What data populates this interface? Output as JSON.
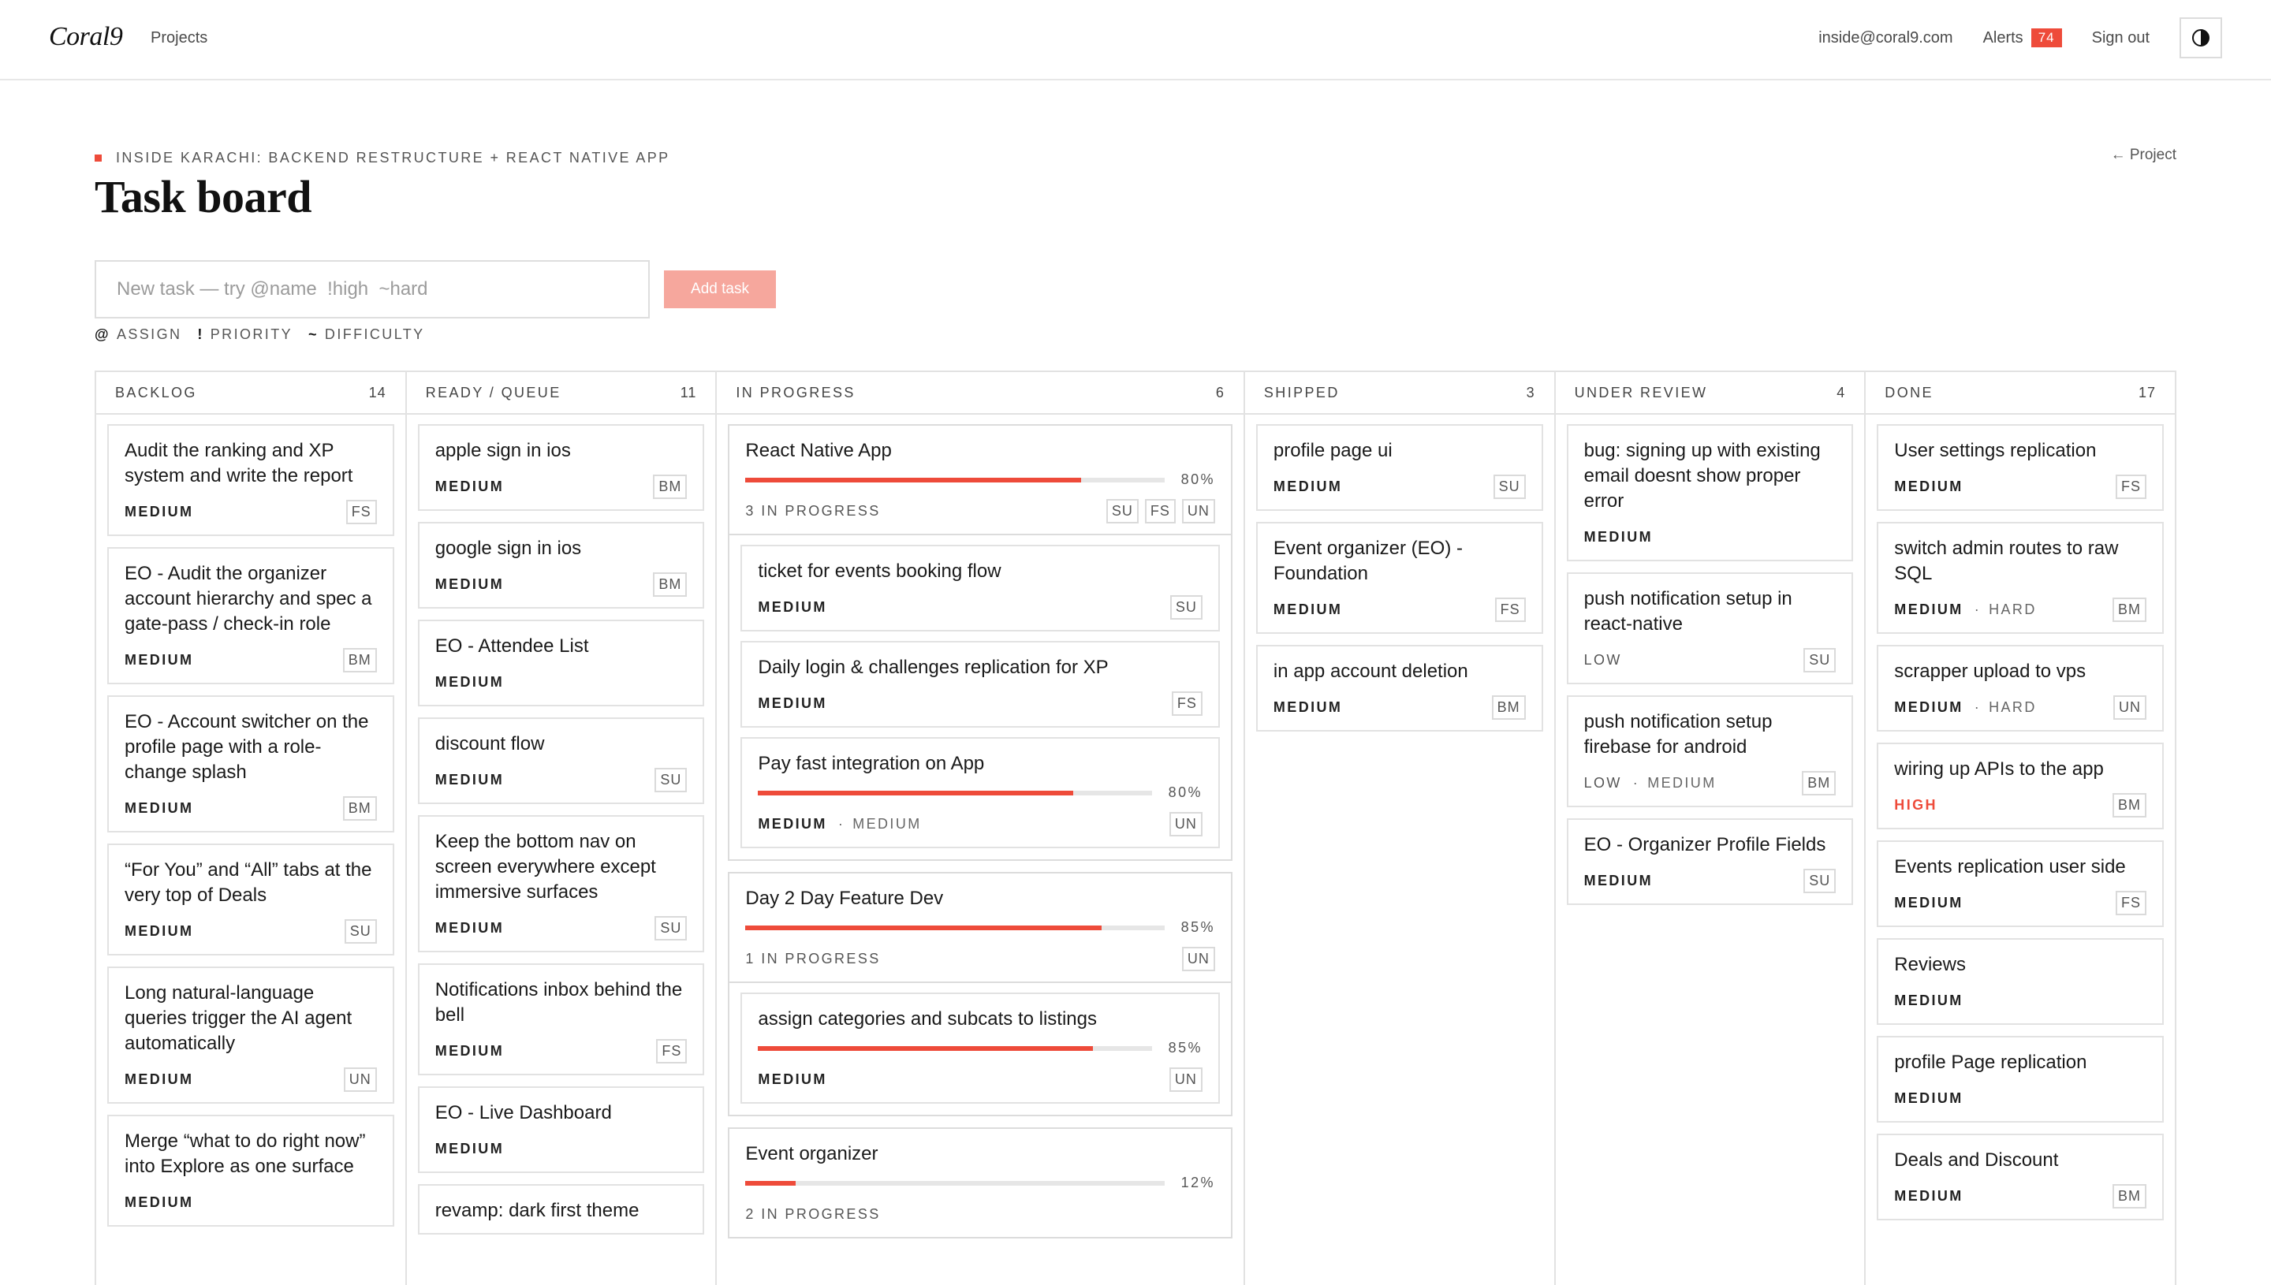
{
  "nav": {
    "logo": "Coral9",
    "projects": "Projects",
    "email": "inside@coral9.com",
    "alerts_label": "Alerts",
    "alerts_count": "74",
    "signout": "Sign out",
    "theme_icon": "contrast-icon"
  },
  "header": {
    "breadcrumb": "INSIDE KARACHI: BACKEND RESTRUCTURE + REACT NATIVE APP",
    "title": "Task board",
    "back_link": "← Project"
  },
  "new_task": {
    "placeholder": "New task — try @name  !high  ~hard",
    "button": "Add task",
    "hints": [
      {
        "symbol": "@",
        "label": "ASSIGN"
      },
      {
        "symbol": "!",
        "label": "PRIORITY"
      },
      {
        "symbol": "~",
        "label": "DIFFICULTY"
      }
    ]
  },
  "colors": {
    "accent": "#ee4b3a",
    "accent_light": "#f6a79d",
    "border": "#e2e2e2"
  },
  "columns": [
    {
      "name": "BACKLOG",
      "count": "14",
      "cards": [
        {
          "title": "Audit the ranking and XP system and write the report",
          "priority": "MEDIUM",
          "assignee": "FS"
        },
        {
          "title": "EO - Audit the organizer account hierarchy and spec a gate-pass / check-in role",
          "priority": "MEDIUM",
          "assignee": "BM"
        },
        {
          "title": "EO - Account switcher on the profile page with a role-change splash",
          "priority": "MEDIUM",
          "assignee": "BM"
        },
        {
          "title": "“For You” and “All” tabs at the very top of Deals",
          "priority": "MEDIUM",
          "assignee": "SU"
        },
        {
          "title": "Long natural-language queries trigger the AI agent automatically",
          "priority": "MEDIUM",
          "assignee": "UN"
        },
        {
          "title": "Merge “what to do right now” into Explore as one surface",
          "priority": "MEDIUM",
          "assignee": ""
        }
      ]
    },
    {
      "name": "READY / QUEUE",
      "count": "11",
      "cards": [
        {
          "title": "apple sign in ios",
          "priority": "MEDIUM",
          "assignee": "BM"
        },
        {
          "title": "google sign in ios",
          "priority": "MEDIUM",
          "assignee": "BM"
        },
        {
          "title": "EO - Attendee List",
          "priority": "MEDIUM",
          "assignee": ""
        },
        {
          "title": "discount flow",
          "priority": "MEDIUM",
          "assignee": "SU"
        },
        {
          "title": "Keep the bottom nav on screen everywhere except immersive surfaces",
          "priority": "MEDIUM",
          "assignee": "SU"
        },
        {
          "title": "Notifications inbox behind the bell",
          "priority": "MEDIUM",
          "assignee": "FS"
        },
        {
          "title": "EO - Live Dashboard",
          "priority": "MEDIUM",
          "assignee": ""
        },
        {
          "title": "revamp: dark first theme",
          "priority": "",
          "assignee": ""
        }
      ]
    },
    {
      "name": "IN PROGRESS",
      "count": "6",
      "epics": [
        {
          "title": "React Native App",
          "progress": 80,
          "progress_label": "80%",
          "status": "3 IN PROGRESS",
          "assignees": [
            "SU",
            "FS",
            "UN"
          ],
          "children": [
            {
              "title": "ticket for events booking flow",
              "priority": "MEDIUM",
              "difficulty": "",
              "assignee": "SU"
            },
            {
              "title": "Daily login & challenges replication for XP",
              "priority": "MEDIUM",
              "difficulty": "",
              "assignee": "FS"
            },
            {
              "title": "Pay fast integration on App",
              "priority": "MEDIUM",
              "difficulty": "MEDIUM",
              "assignee": "UN",
              "progress": 80,
              "progress_label": "80%"
            }
          ]
        },
        {
          "title": "Day 2 Day Feature Dev",
          "progress": 85,
          "progress_label": "85%",
          "status": "1 IN PROGRESS",
          "assignees": [
            "UN"
          ],
          "children": [
            {
              "title": "assign categories and subcats to listings",
              "priority": "MEDIUM",
              "difficulty": "",
              "assignee": "UN",
              "progress": 85,
              "progress_label": "85%"
            }
          ]
        },
        {
          "title": "Event organizer",
          "progress": 12,
          "progress_label": "12%",
          "status": "2 IN PROGRESS",
          "assignees": [],
          "children": []
        }
      ]
    },
    {
      "name": "SHIPPED",
      "count": "3",
      "cards": [
        {
          "title": "profile page ui",
          "priority": "MEDIUM",
          "assignee": "SU"
        },
        {
          "title": "Event organizer (EO) - Foundation",
          "priority": "MEDIUM",
          "assignee": "FS"
        },
        {
          "title": "in app account deletion",
          "priority": "MEDIUM",
          "assignee": "BM"
        }
      ]
    },
    {
      "name": "UNDER REVIEW",
      "count": "4",
      "cards": [
        {
          "title": "bug: signing up with existing email doesnt show proper error",
          "priority": "MEDIUM",
          "assignee": ""
        },
        {
          "title": "push notification setup in react-native",
          "priority": "LOW",
          "assignee": "SU"
        },
        {
          "title": "push notification setup firebase for android",
          "priority": "LOW",
          "difficulty": "MEDIUM",
          "assignee": "BM"
        },
        {
          "title": "EO - Organizer Profile Fields",
          "priority": "MEDIUM",
          "assignee": "SU"
        }
      ]
    },
    {
      "name": "DONE",
      "count": "17",
      "cards": [
        {
          "title": "User settings replication",
          "priority": "MEDIUM",
          "assignee": "FS"
        },
        {
          "title": "switch admin routes to raw SQL",
          "priority": "MEDIUM",
          "difficulty": "HARD",
          "assignee": "BM"
        },
        {
          "title": "scrapper upload to vps",
          "priority": "MEDIUM",
          "difficulty": "HARD",
          "assignee": "UN"
        },
        {
          "title": "wiring up APIs to the app",
          "priority": "HIGH",
          "assignee": "BM"
        },
        {
          "title": "Events replication user side",
          "priority": "MEDIUM",
          "assignee": "FS"
        },
        {
          "title": "Reviews",
          "priority": "MEDIUM",
          "assignee": ""
        },
        {
          "title": "profile Page replication",
          "priority": "MEDIUM",
          "assignee": ""
        },
        {
          "title": "Deals and Discount",
          "priority": "MEDIUM",
          "assignee": "BM"
        }
      ]
    }
  ]
}
